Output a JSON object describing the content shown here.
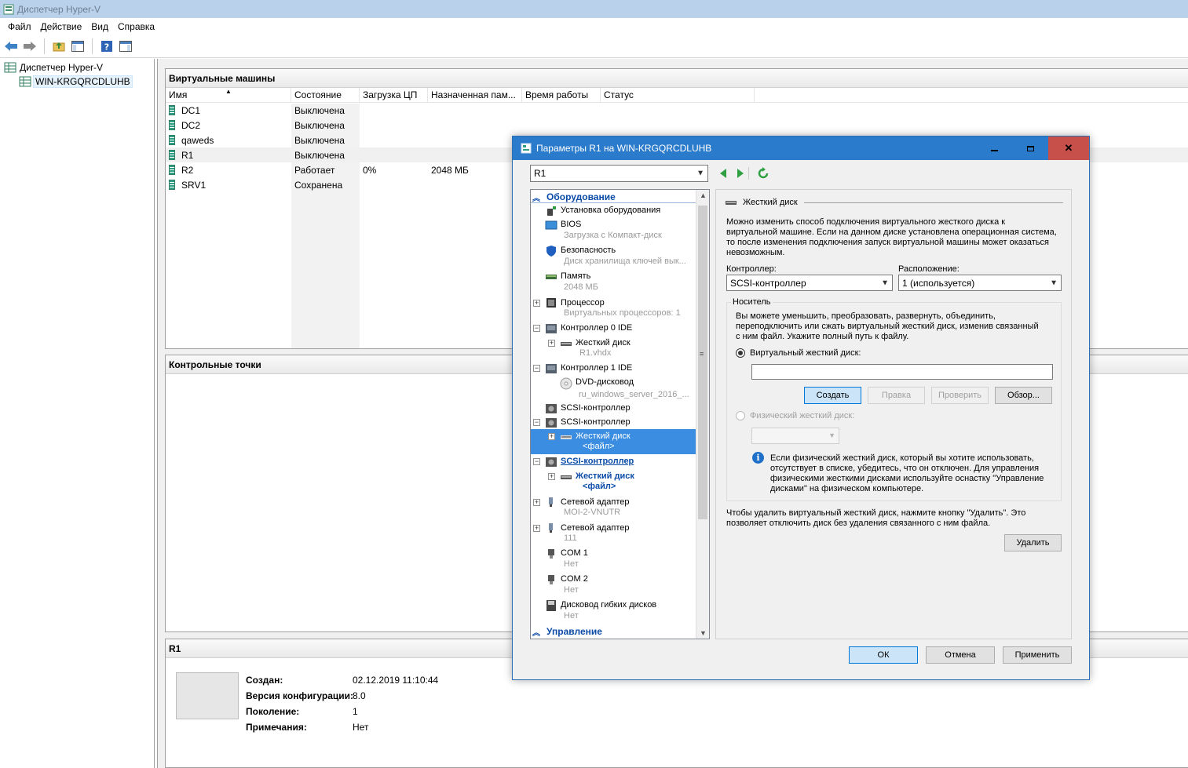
{
  "window": {
    "title": "Диспетчер Hyper-V"
  },
  "menu": [
    "Файл",
    "Действие",
    "Вид",
    "Справка"
  ],
  "tree": {
    "root": "Диспетчер Hyper-V",
    "host": "WIN-KRGQRCDLUHB"
  },
  "vms": {
    "title": "Виртуальные машины",
    "columns": [
      "Имя",
      "Состояние",
      "Загрузка ЦП",
      "Назначенная пам...",
      "Время работы",
      "Статус"
    ],
    "rows": [
      {
        "name": "DC1",
        "state": "Выключена",
        "cpu": "",
        "mem": ""
      },
      {
        "name": "DC2",
        "state": "Выключена",
        "cpu": "",
        "mem": ""
      },
      {
        "name": "qaweds",
        "state": "Выключена",
        "cpu": "",
        "mem": ""
      },
      {
        "name": "R1",
        "state": "Выключена",
        "cpu": "",
        "mem": ""
      },
      {
        "name": "R2",
        "state": "Работает",
        "cpu": "0%",
        "mem": "2048 МБ"
      },
      {
        "name": "SRV1",
        "state": "Сохранена",
        "cpu": "",
        "mem": ""
      }
    ]
  },
  "checkpoints": {
    "title": "Контрольные точки"
  },
  "details": {
    "title": "R1",
    "created_label": "Создан:",
    "created": "02.12.2019 11:10:44",
    "config_label": "Версия конфигурации:",
    "config": "8.0",
    "gen_label": "Поколение:",
    "gen": "1",
    "notes_label": "Примечания:",
    "notes": "Нет"
  },
  "dialog": {
    "title": "Параметры R1 на WIN-KRGQRCDLUHB",
    "vm_select": "R1",
    "hw": {
      "section_hw": "Оборудование",
      "add_hw": "Установка оборудования",
      "bios": "BIOS",
      "bios_sub": "Загрузка с Компакт-диск",
      "security": "Безопасность",
      "security_sub": "Диск хранилища ключей вык...",
      "memory": "Память",
      "memory_sub": "2048 МБ",
      "cpu": "Процессор",
      "cpu_sub": "Виртуальных процессоров: 1",
      "ide0": "Контроллер 0 IDE",
      "hdd1": "Жесткий диск",
      "hdd1_sub": "R1.vhdx",
      "ide1": "Контроллер 1 IDE",
      "dvd": "DVD-дисковод",
      "dvd_sub": "ru_windows_server_2016_...",
      "scsi1": "SCSI-контроллер",
      "scsi2": "SCSI-контроллер",
      "hdd2": "Жесткий диск",
      "hdd2_sub": "<файл>",
      "scsi3": "SCSI-контроллер",
      "hdd3": "Жесткий диск",
      "hdd3_sub": "<файл>",
      "nic1": "Сетевой адаптер",
      "nic1_sub": "MOI-2-VNUTR",
      "nic2": "Сетевой адаптер",
      "nic2_sub": "111",
      "com1": "COM 1",
      "com1_sub": "Нет",
      "com2": "COM 2",
      "com2_sub": "Нет",
      "floppy": "Дисковод гибких дисков",
      "floppy_sub": "Нет",
      "section_mgmt": "Управление"
    },
    "pane": {
      "title": "Жесткий диск",
      "intro": [
        "Можно изменить способ подключения виртуального жесткого диска к",
        "виртуальной машине. Если на данном диске установлена операционная система,",
        "то после изменения подключения запуск виртуальной машины может оказаться",
        "невозможным."
      ],
      "controller_label": "Контроллер:",
      "controller_value": "SCSI-контроллер",
      "location_label": "Расположение:",
      "location_value": "1 (используется)",
      "media_label": "Носитель",
      "media_text": [
        "Вы можете уменьшить, преобразовать, развернуть, объединить,",
        "переподключить или сжать виртуальный жесткий диск, изменив связанный",
        "с ним файл. Укажите полный путь к файлу."
      ],
      "vhd_label": "Виртуальный жесткий диск:",
      "vhd_path": "",
      "btn_create": "Создать",
      "btn_edit": "Правка",
      "btn_inspect": "Проверить",
      "btn_browse": "Обзор...",
      "phys_label": "Физический жесткий диск:",
      "info_text": [
        "Если физический жесткий диск, который вы хотите использовать,",
        "отсутствует в списке, убедитесь, что он отключен. Для управления",
        "физическими жесткими дисками используйте оснастку \"Управление",
        "дисками\" на физическом компьютере."
      ],
      "remove_text": [
        "Чтобы удалить виртуальный жесткий диск, нажмите кнопку \"Удалить\". Это",
        "позволяет отключить диск без удаления связанного с ним файла."
      ],
      "btn_remove": "Удалить"
    },
    "btn_ok": "ОК",
    "btn_cancel": "Отмена",
    "btn_apply": "Применить"
  }
}
